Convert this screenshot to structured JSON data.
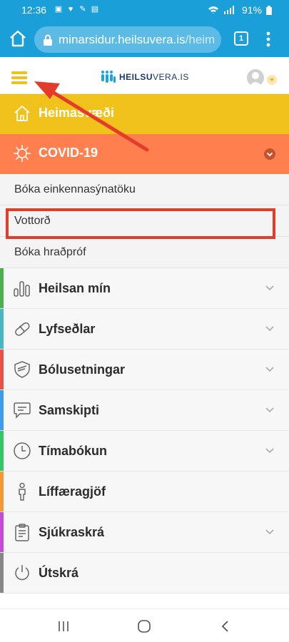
{
  "status_bar": {
    "time": "12:36",
    "battery": "91%"
  },
  "browser": {
    "url_main": "minarsidur.heilsuvera.is",
    "url_tail": "/heim",
    "tab_count": "1"
  },
  "header": {
    "logo_text_bold": "HEILSU",
    "logo_text_light": "VERA.IS"
  },
  "menu": {
    "home_label": "Heimasvæði",
    "covid_label": "COVID-19",
    "covid_sub": [
      "Bóka einkennasýnatöku",
      "Vottorð",
      "Bóka hraðpróf"
    ],
    "items": [
      {
        "label": "Heilsan mín",
        "color": "#4caf50",
        "expandable": true
      },
      {
        "label": "Lyfseðlar",
        "color": "#4ab5c4",
        "expandable": true
      },
      {
        "label": "Bólusetningar",
        "color": "#e5534b",
        "expandable": true
      },
      {
        "label": "Samskipti",
        "color": "#3d9be9",
        "expandable": true
      },
      {
        "label": "Tímabókun",
        "color": "#35c46a",
        "expandable": true
      },
      {
        "label": "Líffæragjöf",
        "color": "#f29a38",
        "expandable": false
      },
      {
        "label": "Sjúkraskrá",
        "color": "#c54bd8",
        "expandable": true
      },
      {
        "label": "Útskrá",
        "color": "#888888",
        "expandable": false
      }
    ]
  },
  "colors": {
    "browser_blue": "#1a9fd9",
    "home_yellow": "#f0c21b",
    "covid_orange": "#ff7f4f",
    "annotation_red": "#e53b2a"
  }
}
